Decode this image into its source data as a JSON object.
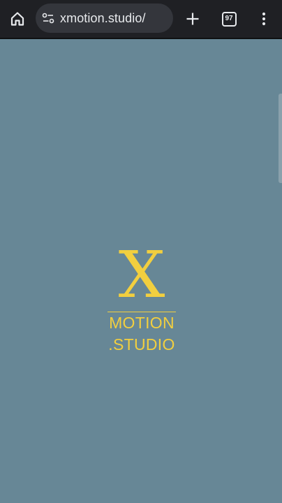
{
  "browser": {
    "url": "xmotion.studio/",
    "tab_count": "97",
    "icons": {
      "home": "home-icon",
      "site_info": "site-info-icon",
      "new_tab": "plus-icon",
      "tabs": "tab-switcher-icon",
      "menu": "more-vert-icon"
    }
  },
  "page": {
    "logo": {
      "mark": "X",
      "line1": "MOTION",
      "line2": ".STUDIO"
    }
  },
  "colors": {
    "background": "#678796",
    "accent": "#f2cf3f",
    "toolbar": "#1f2024"
  }
}
